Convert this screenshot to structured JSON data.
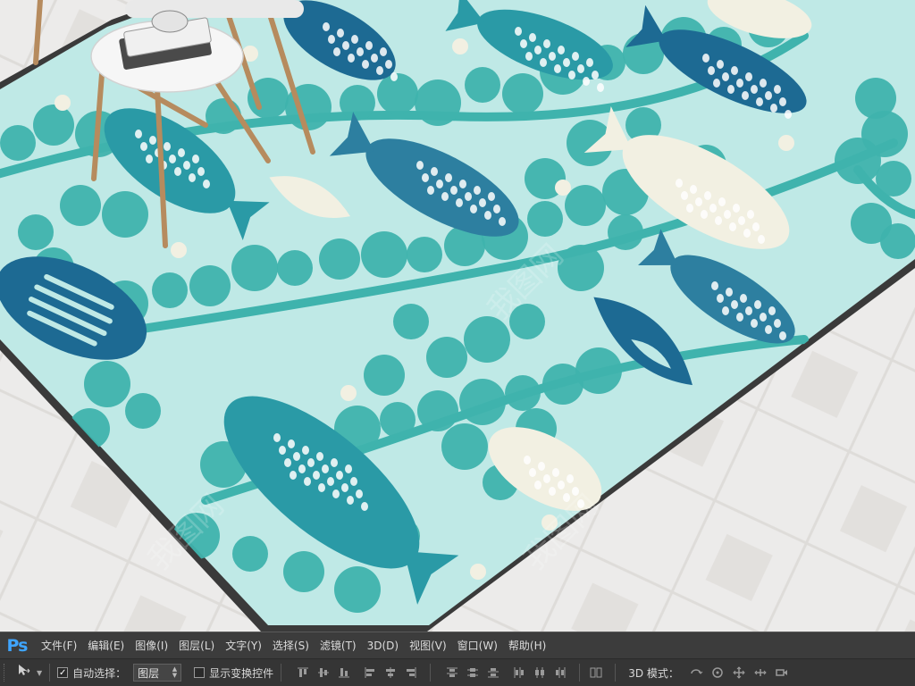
{
  "app": {
    "logo": "Ps"
  },
  "menu": {
    "items": [
      {
        "label": "文件(F)"
      },
      {
        "label": "编辑(E)"
      },
      {
        "label": "图像(I)"
      },
      {
        "label": "图层(L)"
      },
      {
        "label": "文字(Y)"
      },
      {
        "label": "选择(S)"
      },
      {
        "label": "滤镜(T)"
      },
      {
        "label": "3D(D)"
      },
      {
        "label": "视图(V)"
      },
      {
        "label": "窗口(W)"
      },
      {
        "label": "帮助(H)"
      }
    ]
  },
  "options": {
    "auto_select": {
      "label": "自动选择：",
      "checked": true,
      "value": "图层"
    },
    "show_transform": {
      "label": "显示变换控件",
      "checked": false
    },
    "mode_3d_label": "3D 模式："
  },
  "icons": {
    "move_tool": "move-tool-icon",
    "align_buttons": [
      "align-top-edges-icon",
      "align-vertical-centers-icon",
      "align-bottom-edges-icon",
      "align-left-edges-icon",
      "align-horizontal-centers-icon",
      "align-right-edges-icon"
    ],
    "distribute_buttons": [
      "distribute-top-icon",
      "distribute-vcenter-icon",
      "distribute-bottom-icon",
      "distribute-left-icon",
      "distribute-hcenter-icon",
      "distribute-right-icon"
    ],
    "auto_align": "auto-align-layers-icon",
    "mode_3d": [
      "3d-rotate-icon",
      "3d-roll-icon",
      "3d-pan-icon",
      "3d-slide-icon",
      "3d-scale-icon"
    ]
  },
  "colors": {
    "ps_blue": "#3fa5ff",
    "rug_background": "#bfe9e6",
    "rug_leaf": "#3fb3ad",
    "fish_dark": "#1d6a93",
    "fish_teal": "#2a9aa6",
    "fish_cream": "#f2f0e2"
  }
}
